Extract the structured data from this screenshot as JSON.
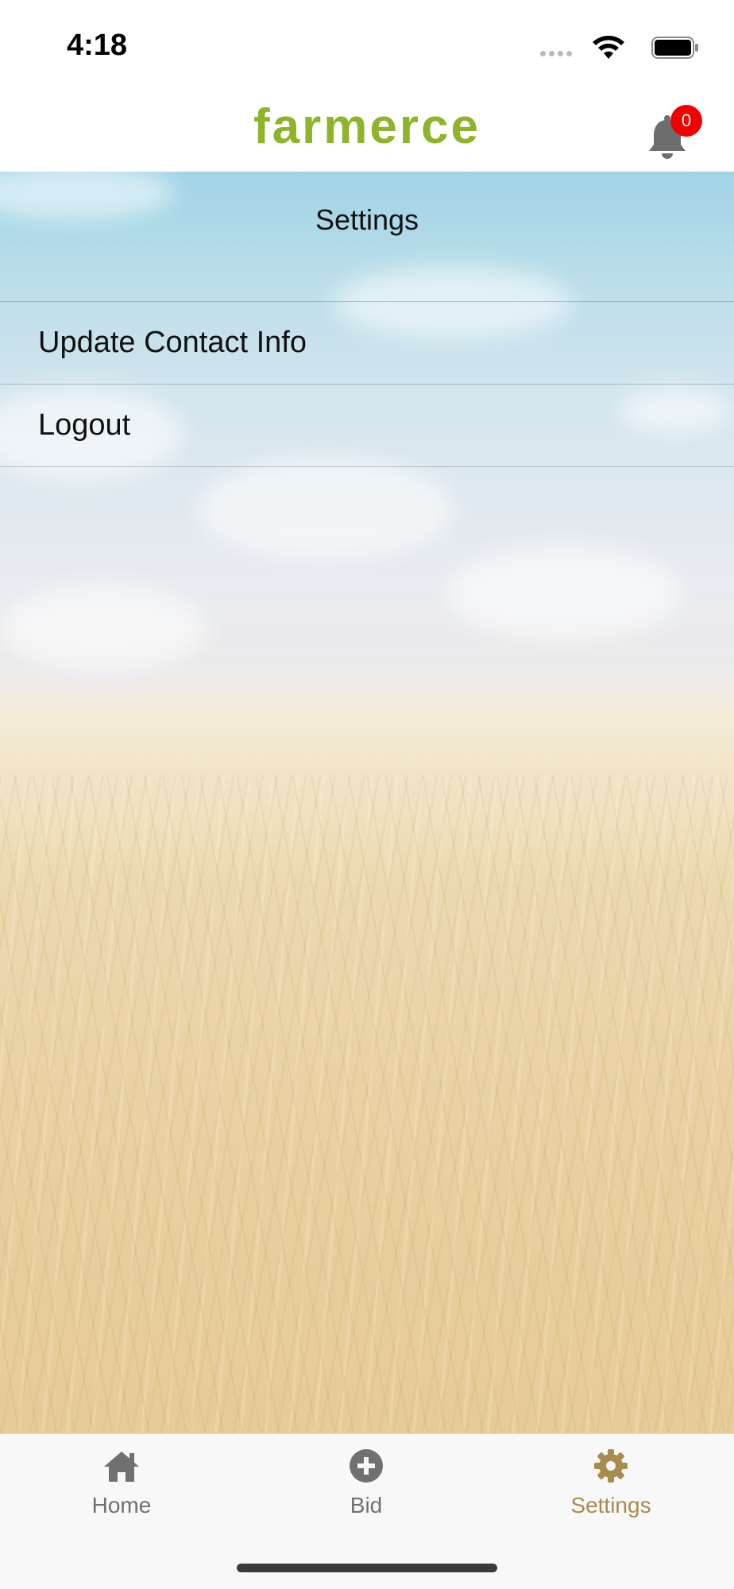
{
  "status_bar": {
    "time": "4:18"
  },
  "header": {
    "logo_text": "farmerce",
    "notification_count": "0"
  },
  "page": {
    "title": "Settings"
  },
  "settings_items": [
    {
      "label": "Update Contact Info"
    },
    {
      "label": "Logout"
    }
  ],
  "tab_bar": {
    "tabs": [
      {
        "label": "Home",
        "icon": "home-icon",
        "active": false
      },
      {
        "label": "Bid",
        "icon": "plus-circle-icon",
        "active": false
      },
      {
        "label": "Settings",
        "icon": "gear-icon",
        "active": true
      }
    ]
  },
  "colors": {
    "brand": "#8db42a",
    "badge": "#f20000",
    "tab_active": "#a88b4f",
    "tab_inactive": "#707070"
  }
}
